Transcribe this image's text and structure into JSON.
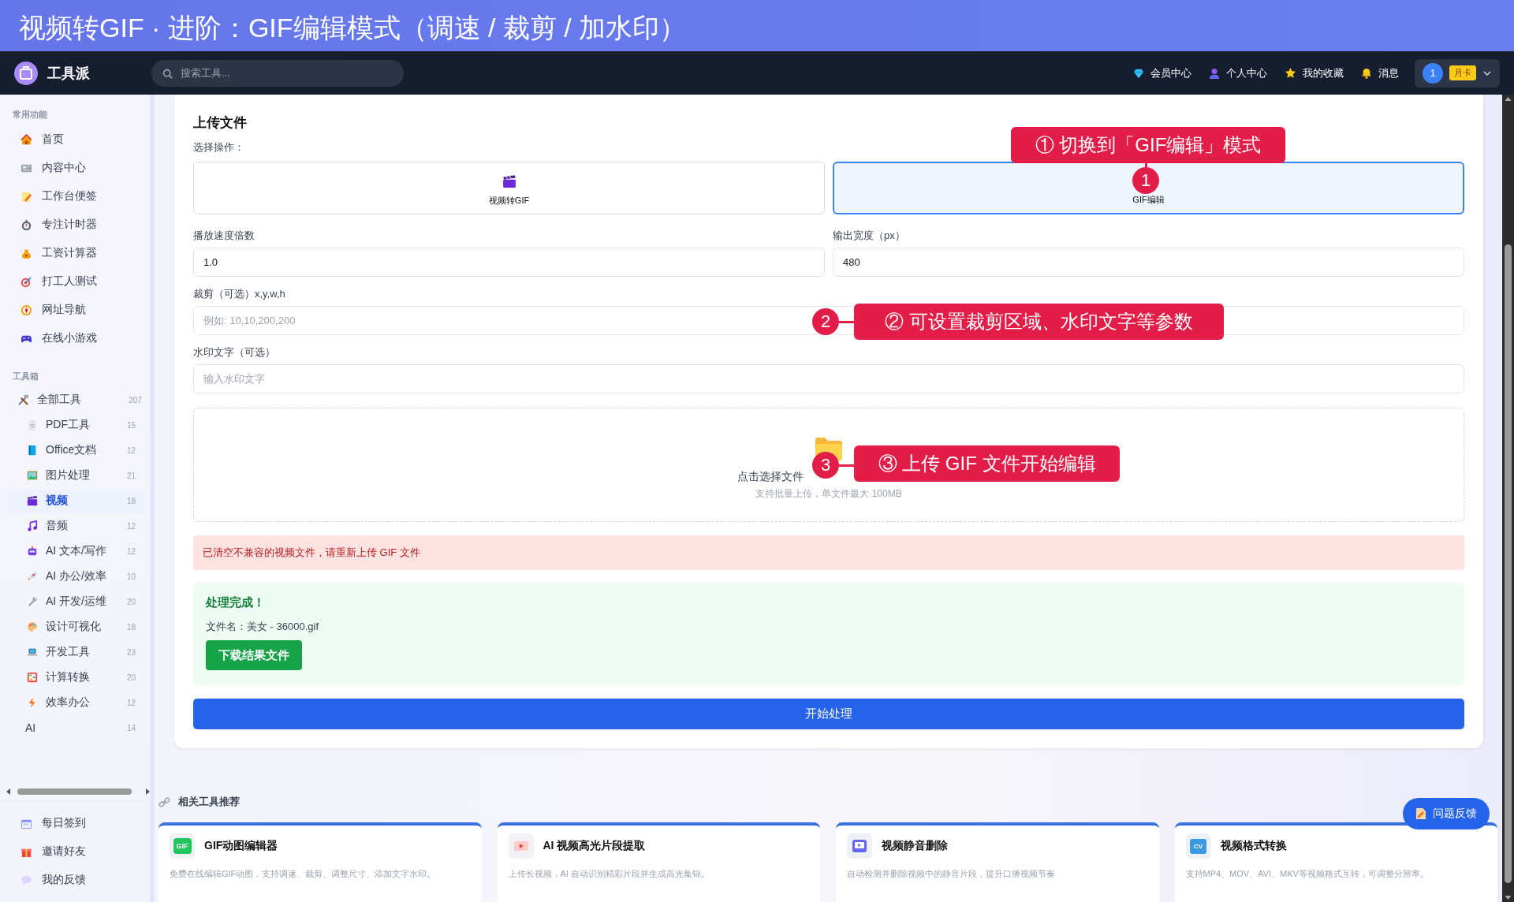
{
  "banner": {
    "title": "视频转GIF · 进阶：GIF编辑模式（调速 / 裁剪 / 加水印）"
  },
  "topnav": {
    "brand": "工具派",
    "search": {
      "placeholder": "搜索工具..."
    },
    "links": [
      "会员中心",
      "个人中心",
      "我的收藏",
      "消息"
    ],
    "avatar": "1",
    "badge": "月卡"
  },
  "sidebar": {
    "sections": [
      {
        "title": "常用功能",
        "items": [
          {
            "label": "首页",
            "selected": false
          },
          {
            "label": "内容中心",
            "selected": false
          },
          {
            "label": "工作台便签",
            "selected": false
          },
          {
            "label": "专注计时器",
            "selected": false
          },
          {
            "label": "工资计算器",
            "selected": false
          },
          {
            "label": "打工人测试",
            "selected": false
          },
          {
            "label": "网址导航",
            "selected": false
          },
          {
            "label": "在线小游戏",
            "selected": false
          }
        ]
      },
      {
        "title": "工具箱",
        "items": [
          {
            "label": "全部工具",
            "count": "207",
            "selected": false,
            "children": [
              {
                "label": "PDF工具",
                "count": "15",
                "selected": false
              },
              {
                "label": "Office文档",
                "count": "12",
                "selected": false
              },
              {
                "label": "图片处理",
                "count": "21",
                "selected": false
              },
              {
                "label": "视频",
                "count": "18",
                "selected": true
              },
              {
                "label": "音频",
                "count": "12",
                "selected": false
              },
              {
                "label": "AI 文本/写作",
                "count": "12",
                "selected": false
              },
              {
                "label": "AI 办公/效率",
                "count": "10",
                "selected": false
              },
              {
                "label": "AI 开发/运维",
                "count": "20",
                "selected": false
              },
              {
                "label": "设计可视化",
                "count": "18",
                "selected": false
              },
              {
                "label": "开发工具",
                "count": "23",
                "selected": false
              },
              {
                "label": "计算转换",
                "count": "20",
                "selected": false
              },
              {
                "label": "效率办公",
                "count": "12",
                "selected": false
              },
              {
                "label": "AI",
                "count": "14",
                "selected": false
              }
            ]
          }
        ]
      }
    ],
    "footer_items": [
      {
        "label": "每日签到",
        "selected": false
      },
      {
        "label": "邀请好友",
        "selected": false
      },
      {
        "label": "我的反馈",
        "selected": false
      }
    ]
  },
  "upload": {
    "title": "上传文件",
    "operation_label": "选择操作：",
    "operations": [
      {
        "label": "视频转GIF",
        "selected": false
      },
      {
        "label": "GIF编辑",
        "selected": true
      }
    ],
    "fields": [
      {
        "label": "播放速度倍数",
        "value": "1.0"
      },
      {
        "label": "输出宽度（px）",
        "value": "480"
      },
      {
        "label": "裁剪（可选）x,y,w,h",
        "placeholder": "例如: 10,10,200,200"
      },
      {
        "label": "水印文字（可选）",
        "placeholder": "输入水印文字"
      }
    ],
    "dropzone": {
      "prompt": "点击选择文件",
      "hint": "支持批量上传，单文件最大 100MB"
    },
    "error": "已清空不兼容的视频文件，请重新上传 GIF 文件",
    "result": {
      "title": "处理完成！",
      "filename": "文件名：美女 - 36000.gif",
      "download_button": "下载结果文件"
    },
    "submit_button": "开始处理"
  },
  "related": {
    "title": "相关工具推荐",
    "cards": [
      {
        "title": "GIF动图编辑器",
        "icon_text": "GIF",
        "description": "免费在线编辑GIF动图，支持调速、裁剪、调整尺寸、添加文字水印。"
      },
      {
        "title": "AI 视频高光片段提取",
        "description": "上传长视频，AI 自动识别精彩片段并生成高光集锦。"
      },
      {
        "title": "视频静音删除",
        "description": "自动检测并删除视频中的静音片段，提升口播视频节奏"
      },
      {
        "title": "视频格式转换",
        "icon_text": "CV",
        "description": "支持MP4、MOV、AVI、MKV等视频格式互转，可调整分辨率。"
      }
    ]
  },
  "feedback_button": "问题反馈",
  "annotations": [
    {
      "number": "1",
      "text": "① 切换到「GIF编辑」模式"
    },
    {
      "number": "2",
      "text": "② 可设置裁剪区域、水印文字等参数"
    },
    {
      "number": "3",
      "text": "③ 上传 GIF 文件开始编辑"
    }
  ]
}
